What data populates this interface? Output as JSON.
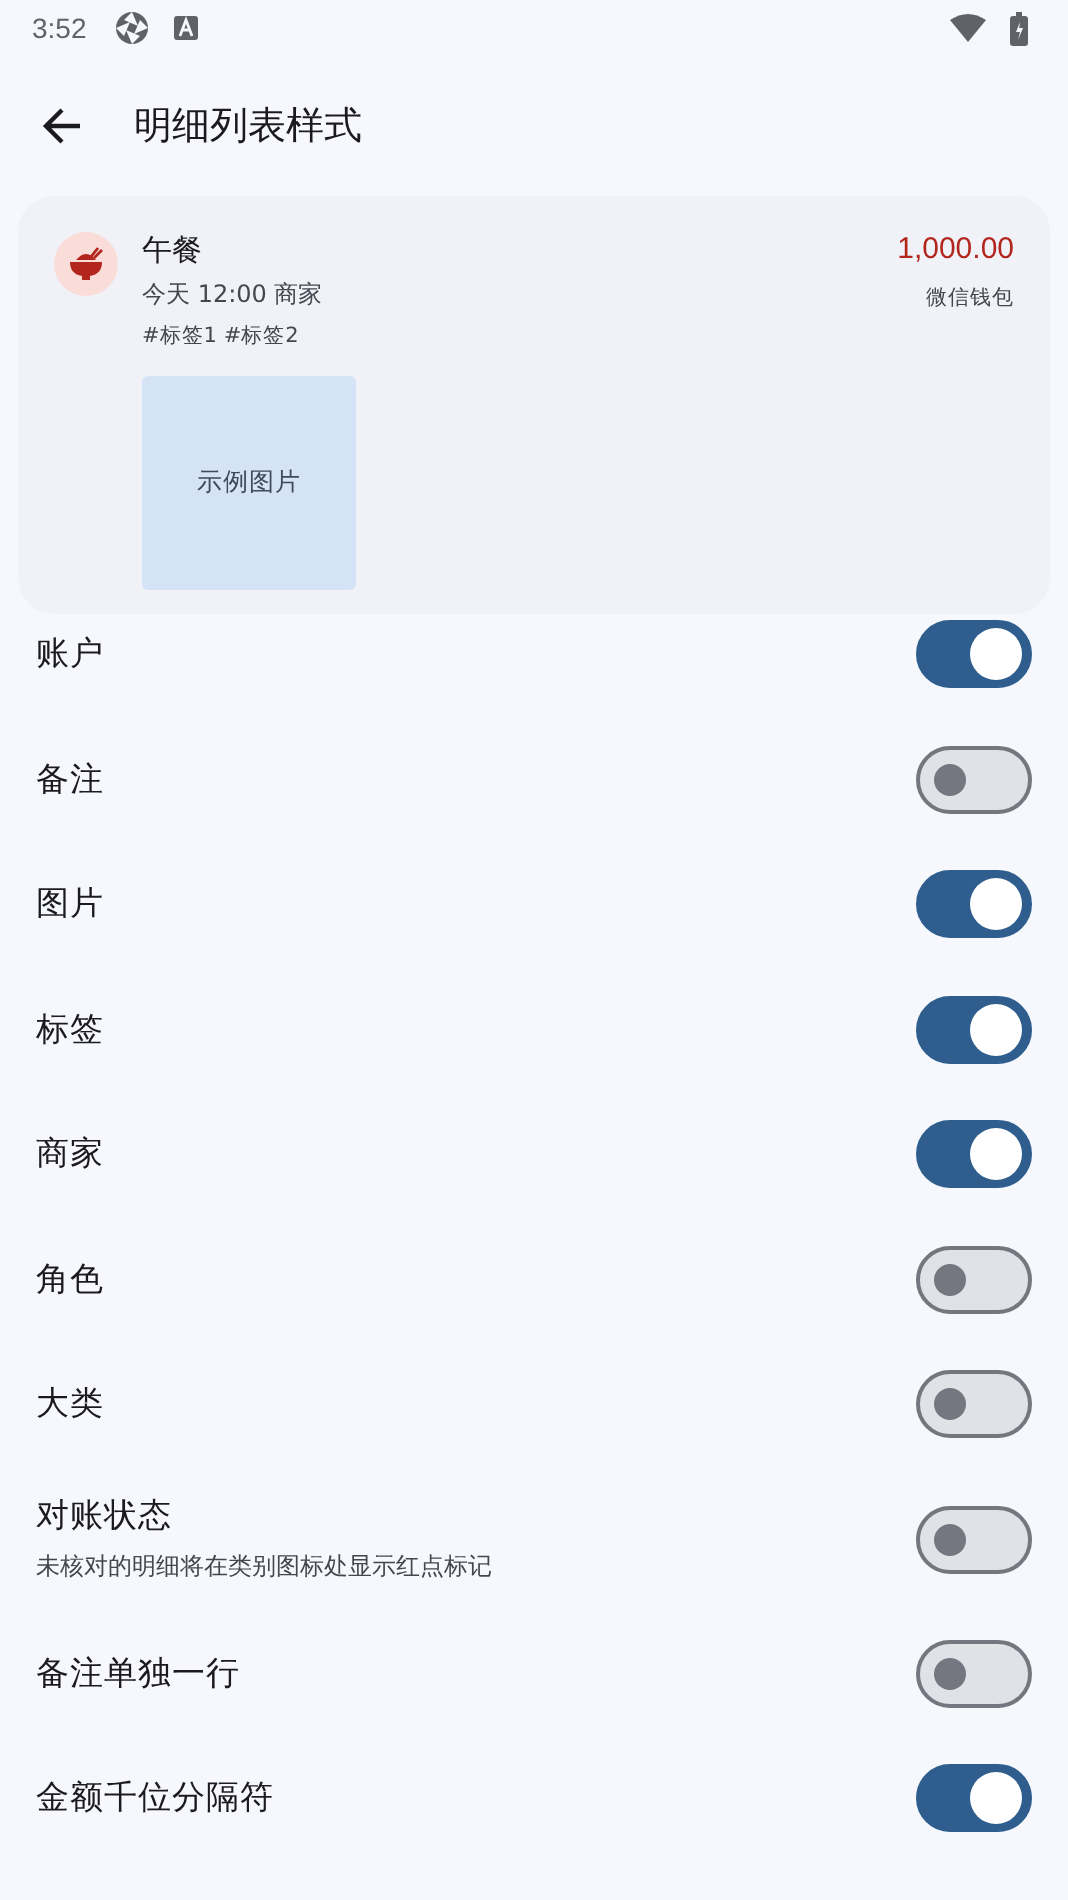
{
  "status_bar": {
    "time": "3:52"
  },
  "app_bar": {
    "title": "明细列表样式"
  },
  "preview": {
    "title": "午餐",
    "subtitle": "今天 12:00 商家",
    "tags": "#标签1 #标签2",
    "amount": "1,000.00",
    "account": "微信钱包",
    "image_label": "示例图片"
  },
  "settings": [
    {
      "label": "账户",
      "on": true
    },
    {
      "label": "备注",
      "on": false
    },
    {
      "label": "图片",
      "on": true
    },
    {
      "label": "标签",
      "on": true
    },
    {
      "label": "商家",
      "on": true
    },
    {
      "label": "角色",
      "on": false
    },
    {
      "label": "大类",
      "on": false
    },
    {
      "label": "对账状态",
      "description": "未核对的明细将在类别图标处显示红点标记",
      "on": false
    },
    {
      "label": "备注单独一行",
      "on": false
    },
    {
      "label": "金额千位分隔符",
      "on": true
    }
  ]
}
